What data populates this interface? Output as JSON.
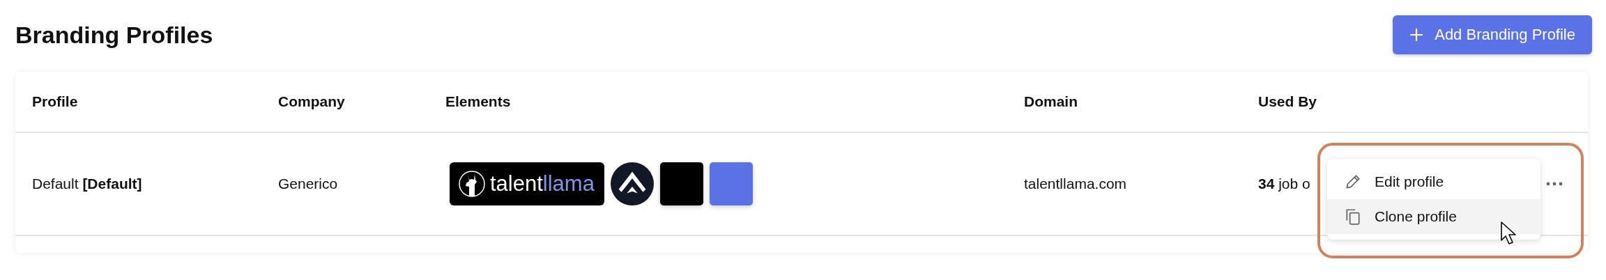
{
  "page": {
    "title": "Branding Profiles",
    "add_button": {
      "label": "Add Branding Profile"
    }
  },
  "table": {
    "columns": [
      "Profile",
      "Company",
      "Elements",
      "Domain",
      "Used By"
    ],
    "rows": [
      {
        "profile": "Default **[Default]**",
        "company": "Generico",
        "elements": {
          "logo": {
            "text_1": "talent",
            "text_2": "llama"
          },
          "swatches": [
            {
              "color": "#000000"
            },
            {
              "color": "#5a72e6"
            }
          ]
        },
        "domain": "talentllama.com",
        "used_by": "**34** job o"
      }
    ]
  },
  "row_menu": {
    "items": [
      {
        "kind": "edit",
        "label": "Edit profile",
        "highlighted": false
      },
      {
        "kind": "clone",
        "label": "Clone profile",
        "highlighted": true
      }
    ]
  }
}
